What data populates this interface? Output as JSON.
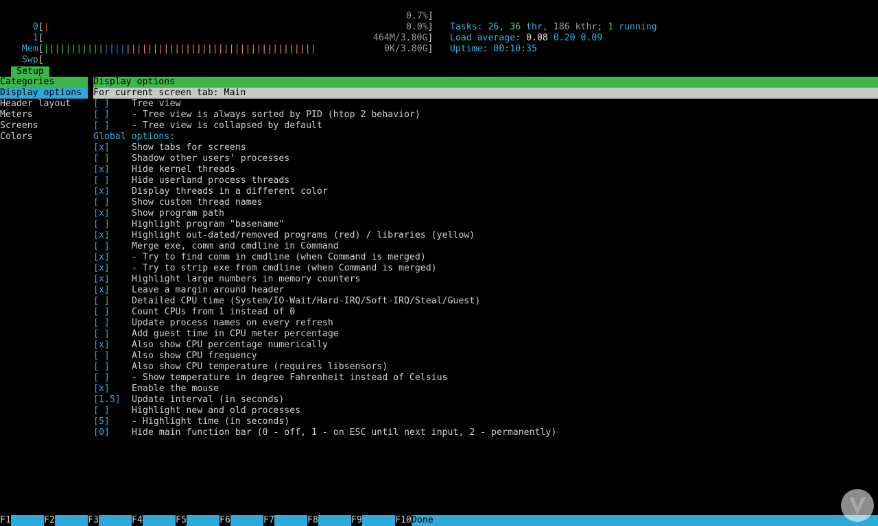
{
  "header": {
    "cpu0": {
      "label": "0",
      "value": "0.7%"
    },
    "cpu1": {
      "label": "1",
      "value": "0.0%"
    },
    "mem": {
      "label": "Mem",
      "value": "464M/3.80G"
    },
    "swp": {
      "label": "Swp",
      "value": "0K/3.80G"
    },
    "tasks": {
      "label": "Tasks:",
      "count": "26,",
      "thr": "36",
      "thr_label": "thr,",
      "kthr": "186 kthr;",
      "running": "1",
      "running_label": "running"
    },
    "load": {
      "label": "Load average:",
      "v1": "0.08",
      "v5": "0.20",
      "v15": "0.09"
    },
    "uptime": {
      "label": "Uptime:",
      "value": "00:10:35"
    }
  },
  "setup_tab": "Setup",
  "categories": {
    "title": "Categories",
    "items": [
      "Display options",
      "Header layout",
      "Meters",
      "Screens",
      "Colors"
    ],
    "selected": 0
  },
  "panel": {
    "title": "Display options",
    "subheader": "For current screen tab: Main",
    "options": [
      {
        "box": "[ ]",
        "text": "Tree view"
      },
      {
        "box": "[ ]",
        "text": "- Tree view is always sorted by PID (htop 2 behavior)"
      },
      {
        "box": "[ ]",
        "text": "- Tree view is collapsed by default"
      },
      {
        "section": "Global options:"
      },
      {
        "box": "[x]",
        "text": "Show tabs for screens"
      },
      {
        "box": "[ ]",
        "text": "Shadow other users' processes"
      },
      {
        "box": "[x]",
        "text": "Hide kernel threads"
      },
      {
        "box": "[ ]",
        "text": "Hide userland process threads"
      },
      {
        "box": "[x]",
        "text": "Display threads in a different color"
      },
      {
        "box": "[ ]",
        "text": "Show custom thread names"
      },
      {
        "box": "[x]",
        "text": "Show program path"
      },
      {
        "box": "[ ]",
        "text": "Highlight program \"basename\""
      },
      {
        "box": "[x]",
        "text": "Highlight out-dated/removed programs (red) / libraries (yellow)"
      },
      {
        "box": "[ ]",
        "text": "Merge exe, comm and cmdline in Command"
      },
      {
        "box": "[x]",
        "text": "- Try to find comm in cmdline (when Command is merged)"
      },
      {
        "box": "[x]",
        "text": "- Try to strip exe from cmdline (when Command is merged)"
      },
      {
        "box": "[x]",
        "text": "Highlight large numbers in memory counters"
      },
      {
        "box": "[x]",
        "text": "Leave a margin around header"
      },
      {
        "box": "[ ]",
        "text": "Detailed CPU time (System/IO-Wait/Hard-IRQ/Soft-IRQ/Steal/Guest)"
      },
      {
        "box": "[ ]",
        "text": "Count CPUs from 1 instead of 0"
      },
      {
        "box": "[ ]",
        "text": "Update process names on every refresh"
      },
      {
        "box": "[ ]",
        "text": "Add guest time in CPU meter percentage"
      },
      {
        "box": "[x]",
        "text": "Also show CPU percentage numerically"
      },
      {
        "box": "[ ]",
        "text": "Also show CPU frequency"
      },
      {
        "box": "[ ]",
        "text": "Also show CPU temperature (requires libsensors)"
      },
      {
        "box": "[ ]",
        "text": "- Show temperature in degree Fahrenheit instead of Celsius"
      },
      {
        "box": "[x]",
        "text": "Enable the mouse"
      },
      {
        "box": "[1.5]",
        "text": "Update interval (in seconds)"
      },
      {
        "box": "[ ]",
        "text": "Highlight new and old processes"
      },
      {
        "box": "[5]",
        "text": "- Highlight time (in seconds)"
      },
      {
        "box": "[0]",
        "text": "Hide main function bar (0 - off, 1 - on ESC until next input, 2 - permanently)"
      }
    ]
  },
  "footer": {
    "keys": [
      "F1",
      "F2",
      "F3",
      "F4",
      "F5",
      "F6",
      "F7",
      "F8",
      "F9",
      "F10"
    ],
    "labels": [
      "",
      "",
      "",
      "",
      "",
      "",
      "",
      "",
      "",
      "Done"
    ]
  },
  "colors": {
    "accent_green": "#3cb54a",
    "accent_cyan": "#2fa9d9",
    "background": "#000000"
  },
  "icons": {
    "watermark": "logo-icon"
  }
}
